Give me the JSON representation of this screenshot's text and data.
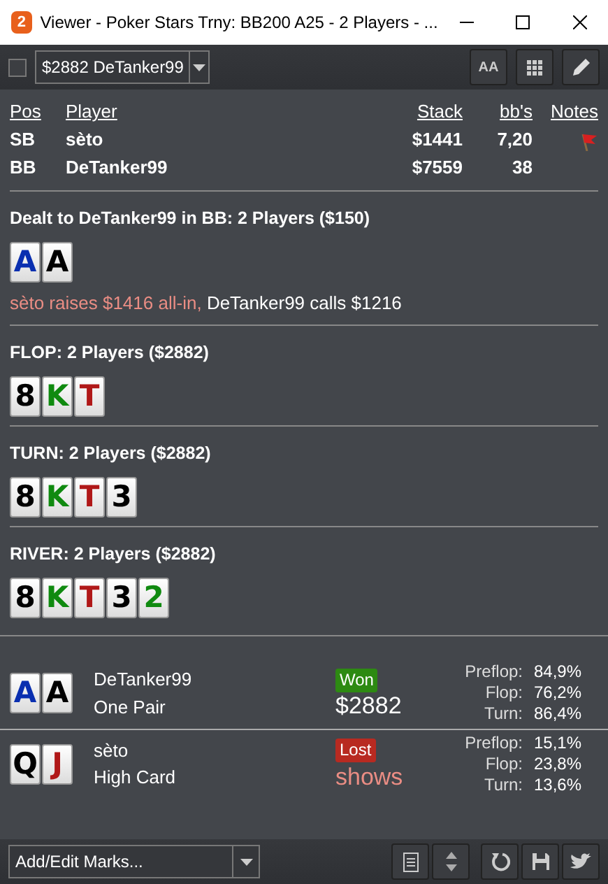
{
  "window": {
    "app_badge": "2",
    "title": "Viewer - Poker Stars Trny: BB200 A25 - 2 Players - ..."
  },
  "toolbar": {
    "checkbox": {
      "checked": false
    },
    "hand_select": {
      "value": "$2882 DeTanker99"
    },
    "font_button": "AA"
  },
  "players_table": {
    "columns": [
      "Pos",
      "Player",
      "Stack",
      "bb's",
      "Notes"
    ],
    "rows": [
      {
        "pos": "SB",
        "player": "sèto",
        "stack": "$1441",
        "bbs": "7,20",
        "flagged": true
      },
      {
        "pos": "BB",
        "player": "DeTanker99",
        "stack": "$7559",
        "bbs": "38",
        "flagged": false
      }
    ]
  },
  "streets": [
    {
      "title": "Dealt to DeTanker99 in BB: 2 Players ($150)",
      "cards": [
        {
          "rank": "A",
          "color": "#0a2fb0"
        },
        {
          "rank": "A",
          "color": "#000000"
        }
      ],
      "actions": [
        {
          "kind": "raise",
          "text": "sèto raises $1416 all-in,"
        },
        {
          "kind": "call",
          "text": "DeTanker99 calls $1216"
        }
      ]
    },
    {
      "title": "FLOP: 2 Players ($2882)",
      "cards": [
        {
          "rank": "8",
          "color": "#000000"
        },
        {
          "rank": "K",
          "color": "#108a10"
        },
        {
          "rank": "T",
          "color": "#b01818"
        }
      ]
    },
    {
      "title": "TURN: 2 Players ($2882)",
      "cards": [
        {
          "rank": "8",
          "color": "#000000"
        },
        {
          "rank": "K",
          "color": "#108a10"
        },
        {
          "rank": "T",
          "color": "#b01818"
        },
        {
          "rank": "3",
          "color": "#000000"
        }
      ]
    },
    {
      "title": "RIVER: 2 Players ($2882)",
      "cards": [
        {
          "rank": "8",
          "color": "#000000"
        },
        {
          "rank": "K",
          "color": "#108a10"
        },
        {
          "rank": "T",
          "color": "#b01818"
        },
        {
          "rank": "3",
          "color": "#000000"
        },
        {
          "rank": "2",
          "color": "#108a10"
        }
      ]
    }
  ],
  "results": [
    {
      "cards": [
        {
          "rank": "A",
          "color": "#0a2fb0"
        },
        {
          "rank": "A",
          "color": "#000000"
        }
      ],
      "player": "DeTanker99",
      "hand": "One Pair",
      "kind": "won",
      "badge": "Won",
      "amount": "$2882",
      "equity": [
        {
          "label": "Preflop:",
          "value": "84,9%"
        },
        {
          "label": "Flop:",
          "value": "76,2%"
        },
        {
          "label": "Turn:",
          "value": "86,4%"
        }
      ]
    },
    {
      "cards": [
        {
          "rank": "Q",
          "color": "#000000"
        },
        {
          "rank": "J",
          "color": "#b01818"
        }
      ],
      "player": "sèto",
      "hand": "High Card",
      "kind": "lost",
      "badge": "Lost",
      "amount": "shows",
      "equity": [
        {
          "label": "Preflop:",
          "value": "15,1%"
        },
        {
          "label": "Flop:",
          "value": "23,8%"
        },
        {
          "label": "Turn:",
          "value": "13,6%"
        }
      ]
    }
  ],
  "footer": {
    "marks_select": {
      "value": "Add/Edit Marks..."
    }
  }
}
